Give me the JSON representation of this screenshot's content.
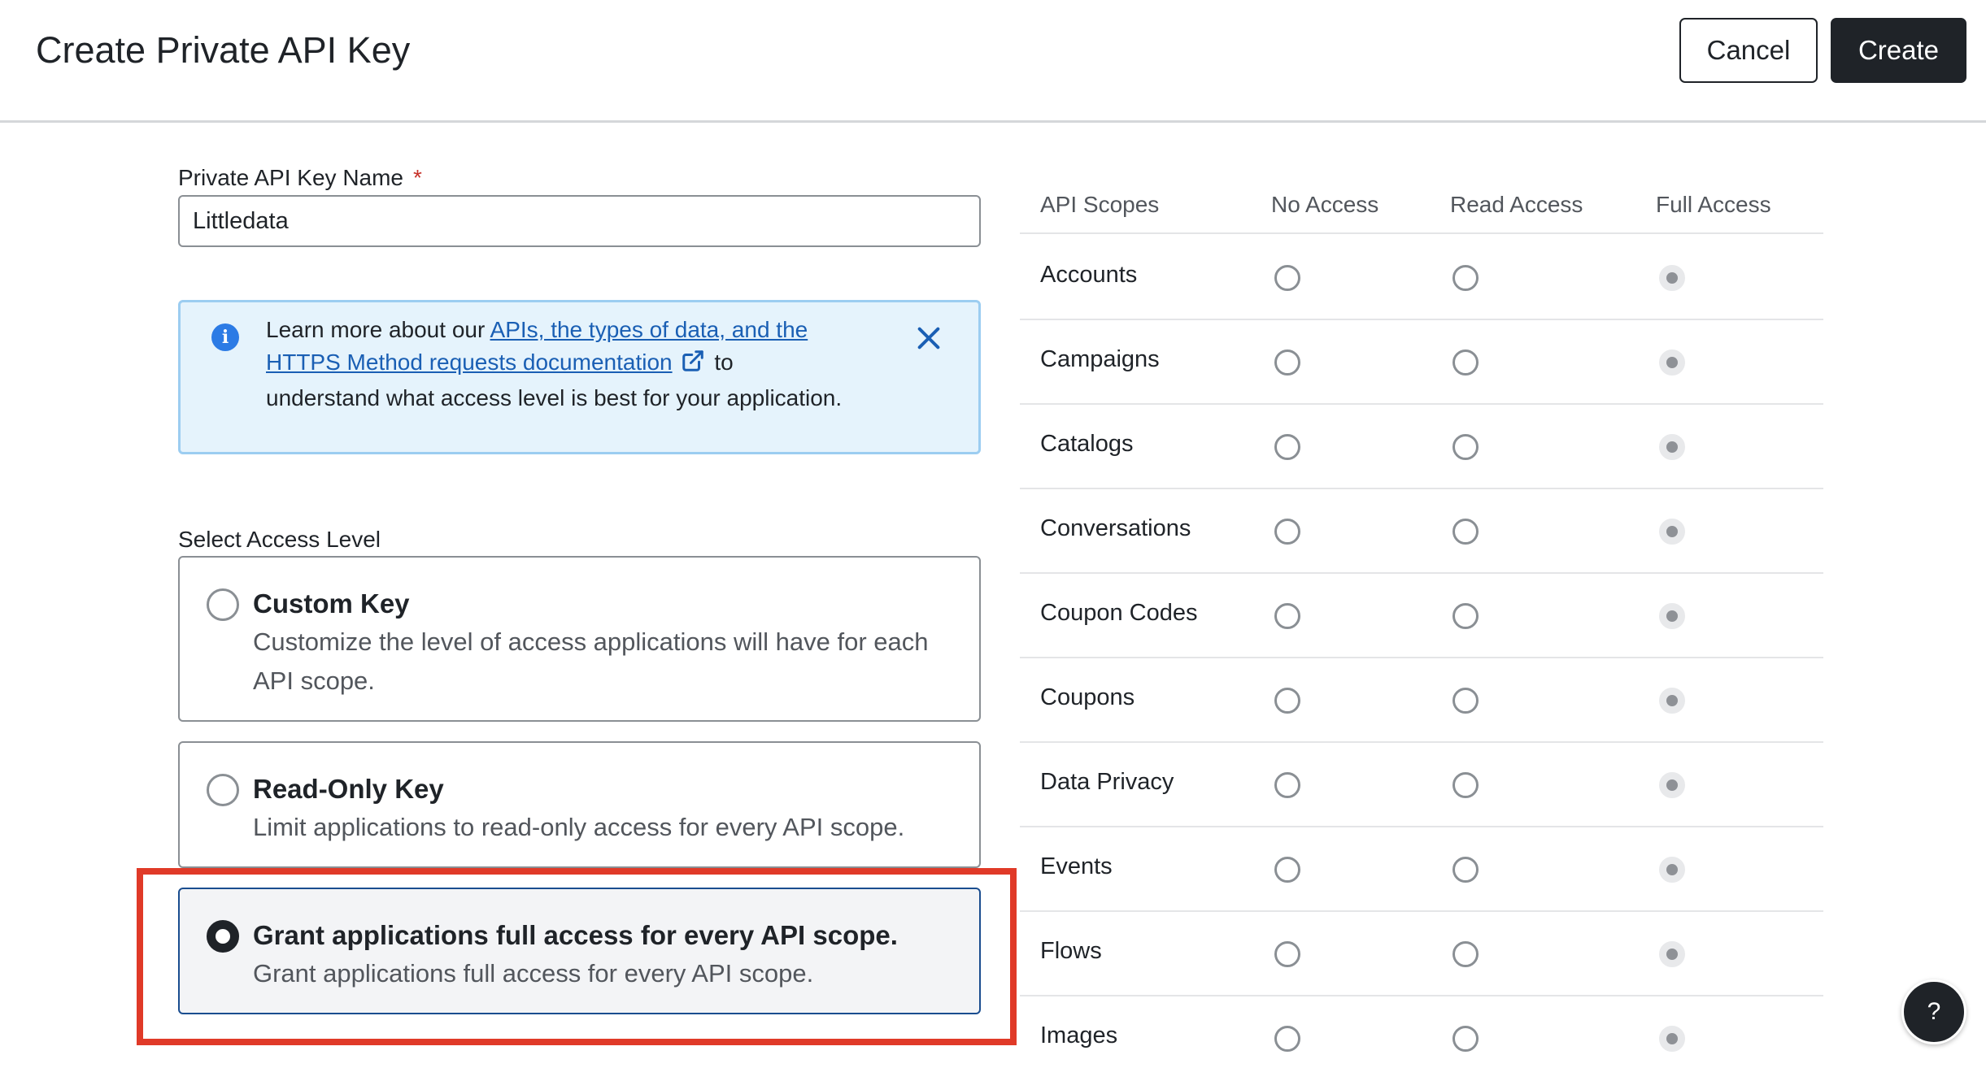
{
  "header": {
    "title": "Create Private API Key",
    "cancel_label": "Cancel",
    "create_label": "Create"
  },
  "name_field": {
    "label": "Private API Key Name",
    "required_marker": "*",
    "value": "Littledata"
  },
  "info_banner": {
    "text_before": "Learn more about our ",
    "link_text": "APIs, the types of data, and the HTTPS Method requests documentation",
    "text_after": "to understand what access level is best for your application."
  },
  "access_level": {
    "label": "Select Access Level",
    "options": [
      {
        "title": "Custom Key",
        "description": "Customize the level of access applications will have for each API scope.",
        "selected": false
      },
      {
        "title": "Read-Only Key",
        "description": "Limit applications to read-only access for every API scope.",
        "selected": false
      },
      {
        "title": "Grant applications full access for every API scope.",
        "description": "Grant applications full access for every API scope.",
        "selected": true
      }
    ]
  },
  "scopes_table": {
    "headers": [
      "API Scopes",
      "No Access",
      "Read Access",
      "Full Access"
    ],
    "rows": [
      {
        "name": "Accounts",
        "selected": "Full Access"
      },
      {
        "name": "Campaigns",
        "selected": "Full Access"
      },
      {
        "name": "Catalogs",
        "selected": "Full Access"
      },
      {
        "name": "Conversations",
        "selected": "Full Access"
      },
      {
        "name": "Coupon Codes",
        "selected": "Full Access"
      },
      {
        "name": "Coupons",
        "selected": "Full Access"
      },
      {
        "name": "Data Privacy",
        "selected": "Full Access"
      },
      {
        "name": "Events",
        "selected": "Full Access"
      },
      {
        "name": "Flows",
        "selected": "Full Access"
      },
      {
        "name": "Images",
        "selected": "Full Access"
      }
    ]
  },
  "help_button": {
    "label": "?"
  },
  "colors": {
    "primary_dark": "#1f2328",
    "info_bg": "#e5f3fc",
    "info_border": "#9ccdf1",
    "link": "#1a5fb4",
    "highlight": "#e03a28",
    "required": "#c7322a"
  }
}
